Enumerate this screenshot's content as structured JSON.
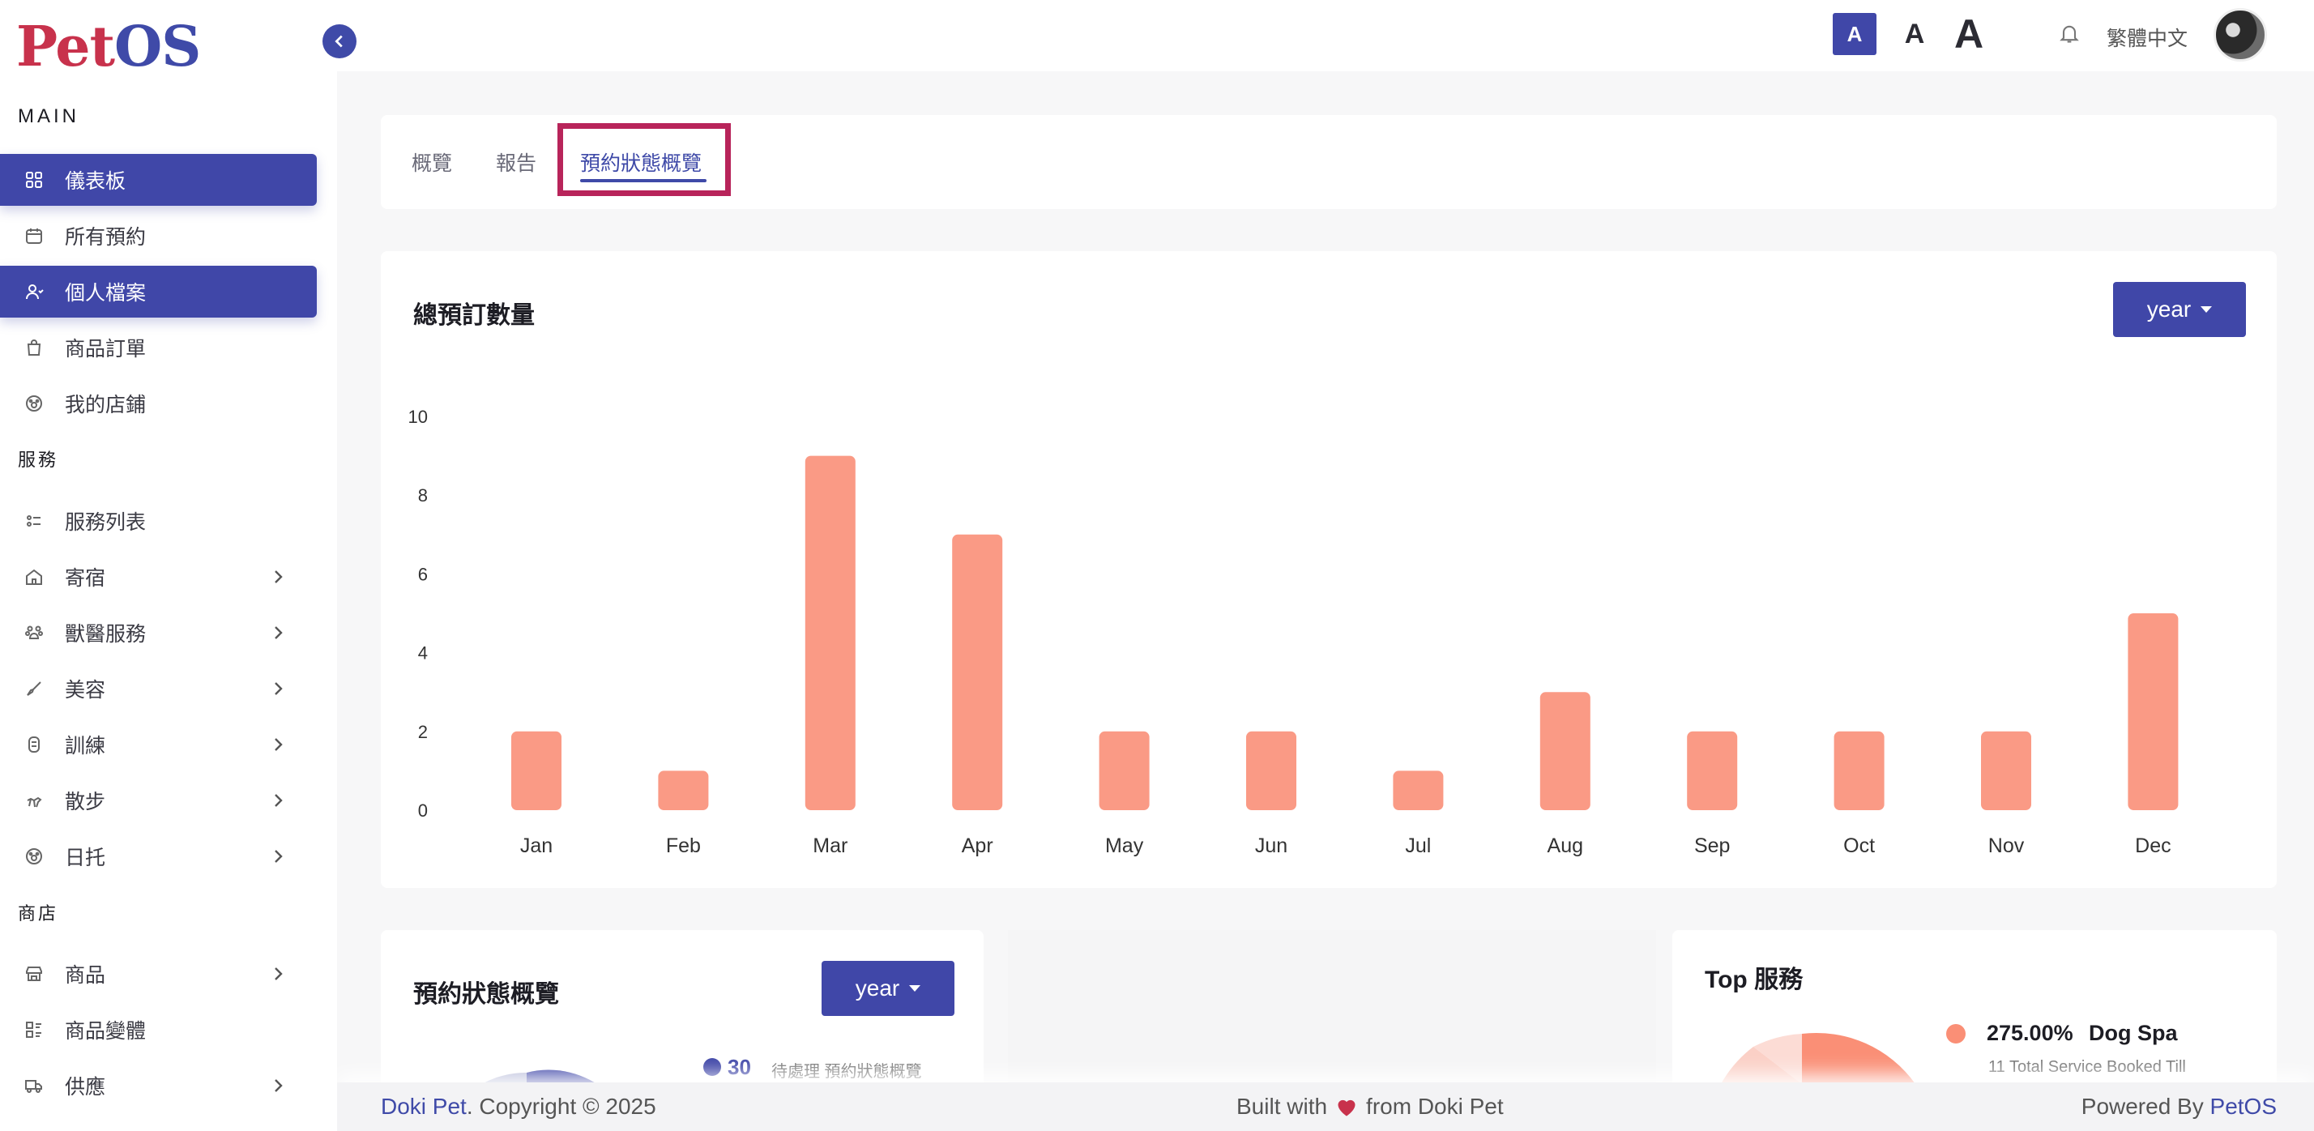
{
  "logo": {
    "part1": "Pet",
    "part2": "OS"
  },
  "sidebar": {
    "main_title": "MAIN",
    "main_items": [
      {
        "label": "儀表板",
        "icon": "grid-icon",
        "active": true
      },
      {
        "label": "所有預約",
        "icon": "calendar-icon",
        "active": false
      },
      {
        "label": "個人檔案",
        "icon": "user-icon",
        "active": true
      },
      {
        "label": "商品訂單",
        "icon": "bag-icon",
        "active": false
      },
      {
        "label": "我的店鋪",
        "icon": "paw-icon",
        "active": false
      }
    ],
    "service_title": "服務",
    "service_items": [
      {
        "label": "服務列表",
        "icon": "list-icon"
      },
      {
        "label": "寄宿",
        "icon": "home-icon"
      },
      {
        "label": "獸醫服務",
        "icon": "paws-icon"
      },
      {
        "label": "美容",
        "icon": "brush-icon"
      },
      {
        "label": "訓練",
        "icon": "training-icon"
      },
      {
        "label": "散步",
        "icon": "dog-walk-icon"
      },
      {
        "label": "日托",
        "icon": "daycare-icon"
      }
    ],
    "store_title": "商店",
    "store_items": [
      {
        "label": "商品",
        "icon": "store-icon"
      },
      {
        "label": "商品變體",
        "icon": "variant-icon"
      },
      {
        "label": "供應",
        "icon": "truck-icon"
      }
    ]
  },
  "header": {
    "font_small": "A",
    "font_medium": "A",
    "font_large": "A",
    "language": "繁體中文"
  },
  "tabs": [
    "概覽",
    "報告",
    "預約狀態概覽"
  ],
  "chart_card": {
    "title": "總預訂數量",
    "period": "year"
  },
  "chart_data": {
    "type": "bar",
    "categories": [
      "Jan",
      "Feb",
      "Mar",
      "Apr",
      "May",
      "Jun",
      "Jul",
      "Aug",
      "Sep",
      "Oct",
      "Nov",
      "Dec"
    ],
    "values": [
      2,
      1,
      9,
      7,
      2,
      2,
      1,
      3,
      2,
      2,
      2,
      5
    ],
    "yticks": [
      "0",
      "2",
      "4",
      "6",
      "8",
      "10"
    ],
    "ylim": [
      0,
      10
    ],
    "bar_color": "#fa9a85",
    "grid": false
  },
  "status_card": {
    "title": "預約狀態概覽",
    "period": "year",
    "legend_count": "30",
    "legend_label": "待處理 預約狀態概覽"
  },
  "top_services": {
    "title": "Top 服務",
    "percent": "275.00%",
    "name": "Dog Spa",
    "sub": "11 Total Service Booked Till"
  },
  "footer": {
    "brand": "Doki Pet",
    "copyright": ". Copyright © 2025",
    "built_pre": "Built with",
    "built_post": "from Doki Pet",
    "powered_pre": "Powered By",
    "powered_brand": "PetOS"
  },
  "colors": {
    "accent": "#4047a8",
    "bar": "#fa9a85",
    "highlight": "#b8245a"
  }
}
